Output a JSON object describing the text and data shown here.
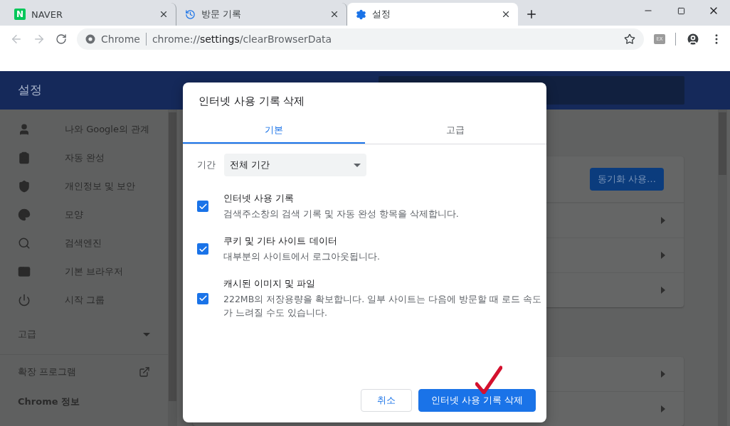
{
  "browser": {
    "tabs": [
      {
        "title": "NAVER",
        "icon_text": "N",
        "selected": false
      },
      {
        "title": "방문 기록",
        "selected": false
      },
      {
        "title": "설정",
        "selected": true
      }
    ],
    "address_bar": {
      "site_label": "Chrome",
      "url": "chrome://**settings**/clearBrowserData"
    },
    "extension_label": "EX"
  },
  "settings": {
    "header": "설정",
    "sidebar": {
      "items": [
        {
          "label": "나와 Google의 관계"
        },
        {
          "label": "자동 완성"
        },
        {
          "label": "개인정보 및 보안"
        },
        {
          "label": "모양"
        },
        {
          "label": "검색엔진"
        },
        {
          "label": "기본 브라우저"
        },
        {
          "label": "시작 그룹"
        }
      ],
      "advanced": {
        "label": "고급",
        "expanded": false
      },
      "extensions": "확장 프로그램",
      "about": "Chrome 정보"
    },
    "sync_button": "동기화 사용…"
  },
  "dialog": {
    "title": "인터넷 사용 기록 삭제",
    "tabs": [
      {
        "label": "기본",
        "selected": true
      },
      {
        "label": "고급",
        "selected": false
      }
    ],
    "period": {
      "label": "기간",
      "value": "전체 기간"
    },
    "options": [
      {
        "title": "인터넷 사용 기록",
        "description": "검색주소창의 검색 기록 및 자동 완성 항목을 삭제합니다.",
        "checked": true
      },
      {
        "title": "쿠키 및 기타 사이트 데이터",
        "description": "대부분의 사이트에서 로그아웃됩니다.",
        "checked": true
      },
      {
        "title": "캐시된 이미지 및 파일",
        "description": "222MB의 저장용량을 확보합니다. 일부 사이트는 다음에 방문할 때 로드 속도가 느려질 수도 있습니다.",
        "checked": true
      }
    ],
    "buttons": [
      {
        "label": "취소",
        "kind": "secondary"
      },
      {
        "label": "인터넷 사용 기록 삭제",
        "kind": "primary"
      }
    ]
  }
}
